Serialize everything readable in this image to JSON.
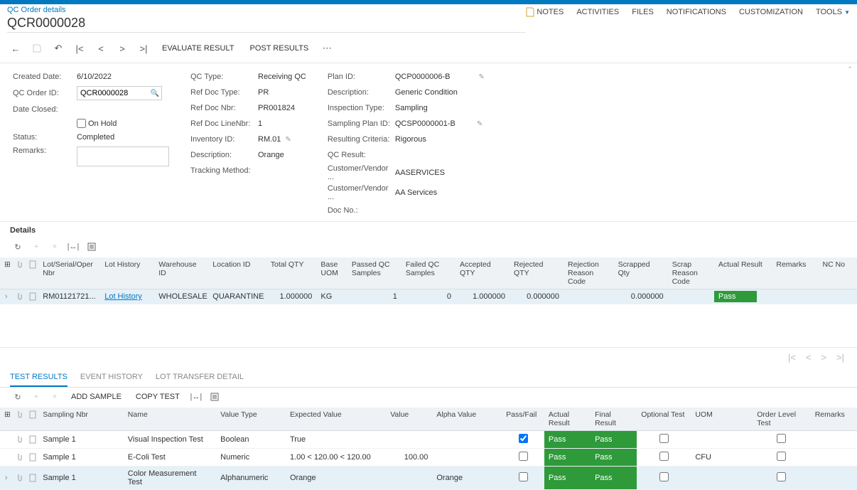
{
  "breadcrumb": "QC Order details",
  "page_title": "QCR0000028",
  "header_links": {
    "notes": "NOTES",
    "activities": "ACTIVITIES",
    "files": "FILES",
    "notifications": "NOTIFICATIONS",
    "customization": "CUSTOMIZATION",
    "tools": "TOOLS"
  },
  "toolbar": {
    "evaluate": "EVALUATE RESULT",
    "post": "POST RESULTS"
  },
  "form": {
    "col1": {
      "created_date_label": "Created Date:",
      "created_date": "6/10/2022",
      "qc_order_id_label": "QC Order ID:",
      "qc_order_id": "QCR0000028",
      "date_closed_label": "Date Closed:",
      "on_hold_label": "On Hold",
      "status_label": "Status:",
      "status": "Completed",
      "remarks_label": "Remarks:"
    },
    "col2": {
      "qc_type_label": "QC Type:",
      "qc_type": "Receiving QC",
      "ref_doc_type_label": "Ref Doc Type:",
      "ref_doc_type": "PR",
      "ref_doc_nbr_label": "Ref Doc Nbr:",
      "ref_doc_nbr": "PR001824",
      "ref_doc_line_label": "Ref Doc LineNbr:",
      "ref_doc_line": "1",
      "inventory_id_label": "Inventory ID:",
      "inventory_id": "RM.01",
      "description_label": "Description:",
      "description": "Orange",
      "tracking_label": "Tracking Method:"
    },
    "col3": {
      "plan_id_label": "Plan ID:",
      "plan_id": "QCP0000006-B",
      "description_label": "Description:",
      "description": "Generic Condition",
      "inspection_type_label": "Inspection Type:",
      "inspection_type": "Sampling",
      "sampling_plan_label": "Sampling Plan ID:",
      "sampling_plan": "QCSP0000001-B",
      "resulting_label": "Resulting Criteria:",
      "resulting": "Rigorous",
      "qc_result_label": "QC Result:",
      "vendor_label": "Customer/Vendor ...",
      "vendor": "AASERVICES",
      "vendor_name_label": "Customer/Vendor ...",
      "vendor_name": "AA Services",
      "doc_no_label": "Doc No.:"
    }
  },
  "details": {
    "title": "Details",
    "columns": {
      "lot": "Lot/Serial/Oper Nbr",
      "lot_history": "Lot History",
      "warehouse": "Warehouse ID",
      "location": "Location ID",
      "total_qty": "Total QTY",
      "base_uom": "Base UOM",
      "passed": "Passed QC Samples",
      "failed": "Failed QC Samples",
      "accepted": "Accepted QTY",
      "rejected": "Rejected QTY",
      "rej_reason": "Rejection Reason Code",
      "scrapped": "Scrapped Qty",
      "scrap_reason": "Scrap Reason Code",
      "actual": "Actual Result",
      "remarks": "Remarks",
      "nc": "NC No"
    },
    "rows": [
      {
        "lot": "RM01121721...",
        "lot_history": "Lot History",
        "warehouse": "WHOLESALE",
        "location": "QUARANTINE",
        "total_qty": "1.000000",
        "base_uom": "KG",
        "passed": "1",
        "failed": "0",
        "accepted": "1.000000",
        "rejected": "0.000000",
        "scrapped": "0.000000",
        "actual": "Pass"
      }
    ]
  },
  "tabs": {
    "test_results": "TEST RESULTS",
    "event_history": "EVENT HISTORY",
    "lot_transfer": "LOT TRANSFER DETAIL"
  },
  "tests": {
    "add_sample": "ADD SAMPLE",
    "copy_test": "COPY TEST",
    "columns": {
      "sampling": "Sampling Nbr",
      "name": "Name",
      "value_type": "Value Type",
      "expected": "Expected Value",
      "value": "Value",
      "alpha": "Alpha Value",
      "passfail": "Pass/Fail",
      "actual": "Actual Result",
      "final": "Final Result",
      "optional": "Optional Test",
      "uom": "UOM",
      "order_level": "Order Level Test",
      "remarks": "Remarks"
    },
    "rows": [
      {
        "sampling": "Sample 1",
        "name": "Visual Inspection Test",
        "value_type": "Boolean",
        "expected": "True",
        "value": "",
        "alpha": "",
        "passfail_checked": true,
        "actual": "Pass",
        "final": "Pass",
        "optional": false,
        "uom": "",
        "order_level": false
      },
      {
        "sampling": "Sample 1",
        "name": "E-Coli Test",
        "value_type": "Numeric",
        "expected": "1.00 < 120.00 < 120.00",
        "value": "100.00",
        "alpha": "",
        "passfail_checked": false,
        "actual": "Pass",
        "final": "Pass",
        "optional": false,
        "uom": "CFU",
        "order_level": false
      },
      {
        "sampling": "Sample 1",
        "name": "Color Measurement Test",
        "value_type": "Alphanumeric",
        "expected": "Orange",
        "value": "",
        "alpha": "Orange",
        "passfail_checked": false,
        "actual": "Pass",
        "final": "Pass",
        "optional": false,
        "uom": "",
        "order_level": false
      }
    ]
  }
}
